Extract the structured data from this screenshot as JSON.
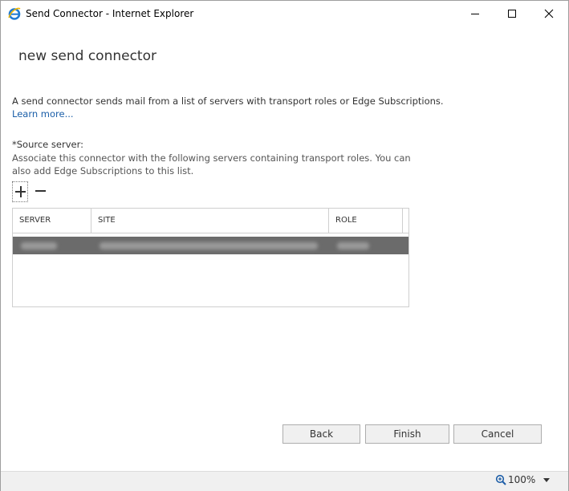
{
  "window": {
    "title": "Send Connector - Internet Explorer",
    "icon": "internet-explorer-icon"
  },
  "page": {
    "heading": "new send connector",
    "description": "A send connector sends mail from a list of servers with transport roles or Edge Subscriptions.",
    "learn_more": "Learn more...",
    "source_label": "*Source server:",
    "source_help": "Associate this connector with the following servers containing transport roles. You can also add Edge Subscriptions to this list."
  },
  "toolbar": {
    "add_icon": "plus-icon",
    "remove_icon": "minus-icon"
  },
  "table": {
    "columns": [
      "SERVER",
      "SITE",
      "ROLE"
    ],
    "rows": [
      {
        "server": "",
        "site": "",
        "role": "",
        "redacted": true
      }
    ]
  },
  "buttons": {
    "back": "Back",
    "finish": "Finish",
    "cancel": "Cancel"
  },
  "statusbar": {
    "zoom": "100%"
  },
  "colors": {
    "link": "#1a5ea8",
    "selected_row": "#6b6b6b"
  }
}
